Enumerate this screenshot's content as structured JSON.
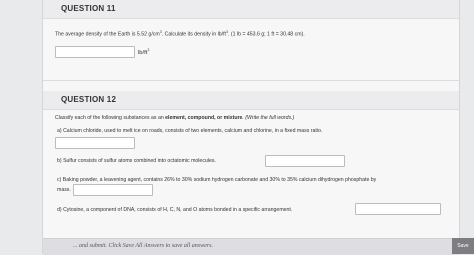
{
  "q11": {
    "title": "QUESTION 11",
    "prompt_a": "The average density of the Earth is 5.52 g/cm",
    "prompt_sup": "3",
    "prompt_b": ". Calculate its density in lb/ft",
    "prompt_sup2": "3",
    "prompt_c": ". (1 lb = 453.6 g; 1 ft = 30.48 cm).",
    "answer": "",
    "unit": "lb/ft",
    "unit_sup": "3"
  },
  "q12": {
    "title": "QUESTION 12",
    "instructions": "Classify each of the following substances as an ",
    "instructions_bold": "element, compound, or mixture",
    "instructions_tail": ". (Write the full words.)",
    "items": [
      {
        "label": "a) ",
        "text": "Calcium chloride, used to melt ice on roads, consists of two elements, calcium and chlorine, in a fixed mass ratio.",
        "answer": ""
      },
      {
        "label": "b) ",
        "text": "Sulfur consists of sulfur atoms combined into octatomic molecules.",
        "answer": ""
      },
      {
        "label": "c) ",
        "text": "Baking powder, a leavening agent, contains 26% to 30% sodium hydrogen carbonate and 30% to 35% calcium dihydrogen phosphate by",
        "text2": "mass.",
        "answer": ""
      },
      {
        "label": "d) ",
        "text": "Cytosine, a component of DNA, consists of H, C, N, and O atoms bonded in a specific arrangement.",
        "answer": ""
      }
    ]
  },
  "footer": {
    "note": "... and submit. Click Save All Answers to save all answers.",
    "save_label": "Save"
  }
}
